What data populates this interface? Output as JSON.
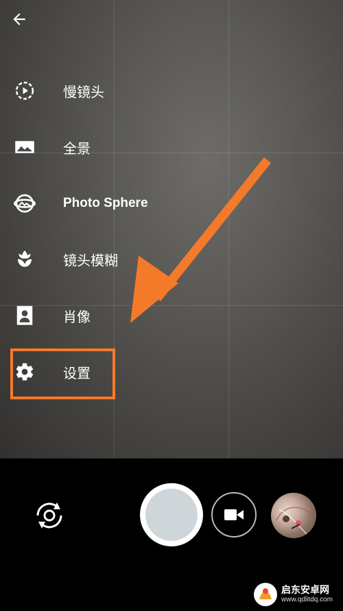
{
  "menu": {
    "items": [
      {
        "label": "慢镜头",
        "icon": "slow-motion-icon"
      },
      {
        "label": "全景",
        "icon": "panorama-icon"
      },
      {
        "label": "Photo Sphere",
        "icon": "photo-sphere-icon"
      },
      {
        "label": "镜头模糊",
        "icon": "lens-blur-icon"
      },
      {
        "label": "肖像",
        "icon": "portrait-icon"
      },
      {
        "label": "设置",
        "icon": "gear-icon"
      }
    ]
  },
  "annotation": {
    "highlight_color": "#f47a2a"
  },
  "controls": {
    "switch_camera_icon": "switch-camera-icon",
    "shutter_icon": "shutter-button",
    "video_icon": "video-camera-icon",
    "gallery_icon": "gallery-thumbnail"
  },
  "watermark": {
    "title": "启东安卓网",
    "url": "www.qdlitdq.com"
  }
}
